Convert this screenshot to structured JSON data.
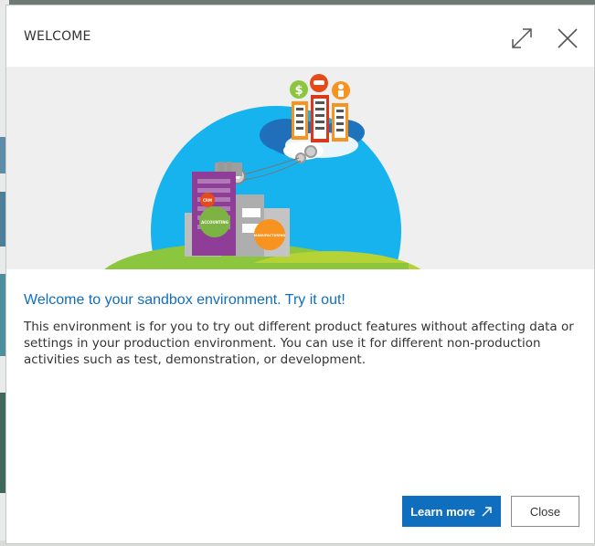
{
  "dialog": {
    "title": "WELCOME",
    "expand_icon": "expand-icon",
    "close_icon": "close-icon",
    "heading": "Welcome to your sandbox environment. Try it out!",
    "body": "This environment is for you to try out different product features without affecting data or settings in your production environment. You can use it for different non-production activities such as test, demonstration, or development.",
    "primary_button": "Learn more",
    "primary_button_icon": "external-link-icon",
    "secondary_button": "Close"
  },
  "illustration": {
    "labels": {
      "crm": "CRM",
      "accounting": "ACCOUNTING",
      "manufacturing": "MANUFACTURING"
    },
    "icons": [
      "dollar-icon",
      "handshake-icon",
      "person-icon",
      "gear-icon"
    ]
  },
  "colors": {
    "accent": "#106ebe",
    "sky": "#17b3ef",
    "hill": "#8cc63f",
    "crm": "#e64a19",
    "accounting": "#7cb342",
    "manufacturing": "#f7931e"
  }
}
